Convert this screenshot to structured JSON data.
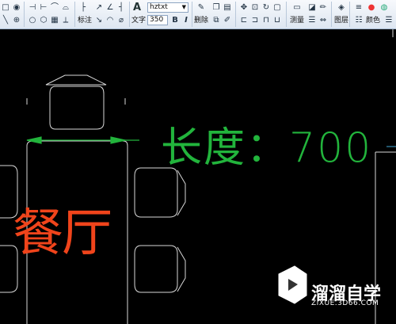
{
  "toolbar": {
    "text_label": "文字",
    "font_combo": "hztxt",
    "size_combo": "350",
    "bold_label": "B",
    "italic_label": "I",
    "dim_label": "标注",
    "delete_label": "删除",
    "measure_label": "测量",
    "color_label": "颜色",
    "layer_label": "图层"
  },
  "drawing": {
    "dimension_text": "长度：700",
    "room_label": "餐厅",
    "colors": {
      "background": "#000000",
      "geometry": "#d9d9d9",
      "dimension": "#22b43c",
      "room": "#f0441b"
    }
  },
  "watermark": {
    "title": "溜溜自学",
    "url": "ZIXUE.3D66.COM"
  }
}
